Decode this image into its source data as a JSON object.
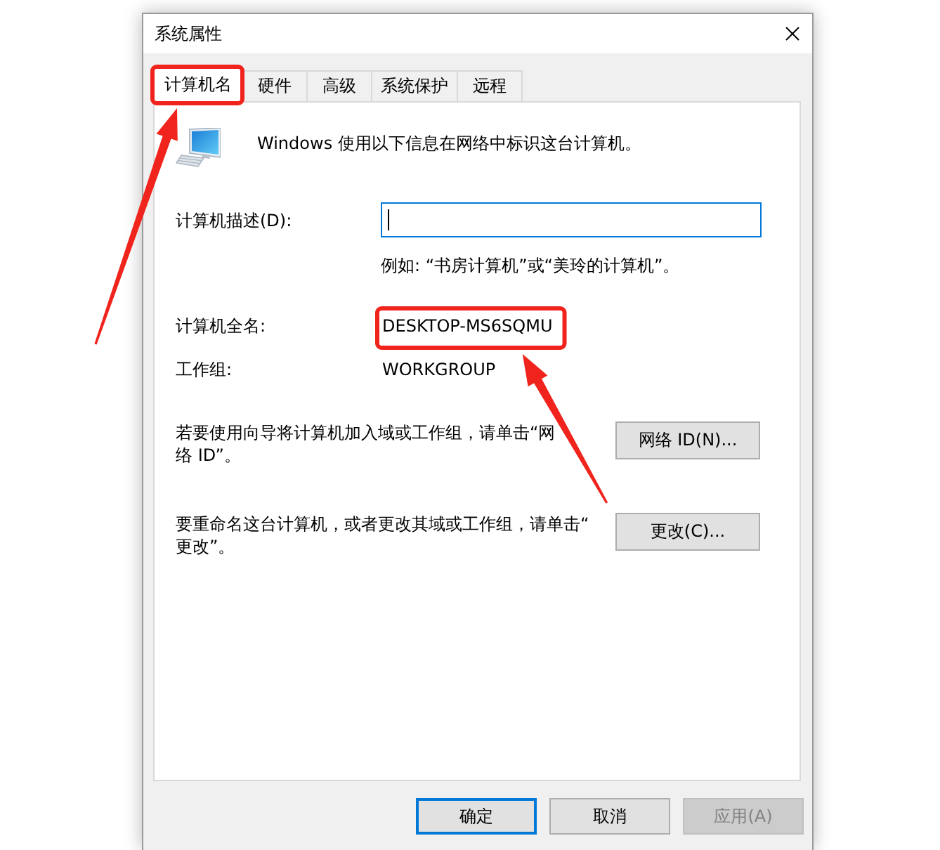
{
  "window": {
    "title": "系统属性"
  },
  "tabs": [
    {
      "label": "计算机名",
      "selected": true,
      "highlighted": true
    },
    {
      "label": "硬件",
      "selected": false,
      "highlighted": false
    },
    {
      "label": "高级",
      "selected": false,
      "highlighted": false
    },
    {
      "label": "系统保护",
      "selected": false,
      "highlighted": false
    },
    {
      "label": "远程",
      "selected": false,
      "highlighted": false
    }
  ],
  "intro": "Windows 使用以下信息在网络中标识这台计算机。",
  "description": {
    "label": "计算机描述(D):",
    "focused": true,
    "hint": "例如: “书房计算机”或“美玲的计算机”。"
  },
  "full_name": {
    "label": "计算机全名:",
    "value": "DESKTOP-MS6SQMU",
    "highlighted": true
  },
  "workgroup": {
    "label": "工作组:",
    "value": "WORKGROUP"
  },
  "actions": [
    {
      "text": "若要使用向导将计算机加入域或工作组，请单击“网络 ID”。",
      "button": "网络 ID(N)..."
    },
    {
      "text": "要重命名这台计算机，或者更改其域或工作组，请单击“更改”。",
      "button": "更改(C)..."
    }
  ],
  "buttons": [
    {
      "label": "确定",
      "default": true,
      "disabled": false
    },
    {
      "label": "取消",
      "default": false,
      "disabled": false
    },
    {
      "label": "应用(A)",
      "default": false,
      "disabled": true
    }
  ]
}
